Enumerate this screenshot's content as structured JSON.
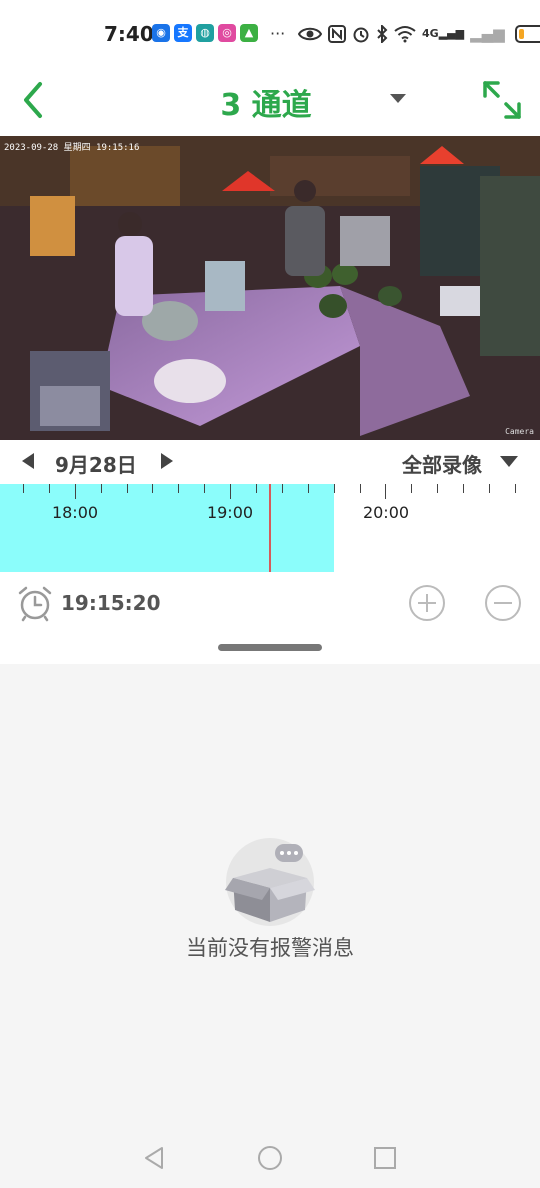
{
  "status_bar": {
    "time": "7:40",
    "apps": [
      {
        "icon": "app-blue-icon",
        "color": "#1a73e8",
        "glyph": "◉"
      },
      {
        "icon": "alipay-icon",
        "color": "#1677ff",
        "glyph": "支"
      },
      {
        "icon": "app-teal-icon",
        "color": "#20a0a0",
        "glyph": "◍"
      },
      {
        "icon": "app-pink-icon",
        "color": "#e04aa0",
        "glyph": "◎"
      },
      {
        "icon": "app-green-icon",
        "color": "#3cb043",
        "glyph": "▲"
      }
    ],
    "more": "···",
    "signal_text": "4G",
    "battery_level": 0.2
  },
  "header": {
    "title": "3 通道"
  },
  "video": {
    "osd_text": "2023-09-28  星期四  19:15:16",
    "camera_label": "Camera"
  },
  "date_nav": {
    "date": "9月28日",
    "filter": "全部录像"
  },
  "timeline": {
    "labels": [
      "18:00",
      "19:00",
      "20:00"
    ],
    "record_color": "#8bfdfb",
    "cursor_color": "#d65a5a"
  },
  "playback": {
    "current_time": "19:15:20"
  },
  "alarms": {
    "empty_text": "当前没有报警消息"
  },
  "colors": {
    "accent": "#2da84c"
  }
}
